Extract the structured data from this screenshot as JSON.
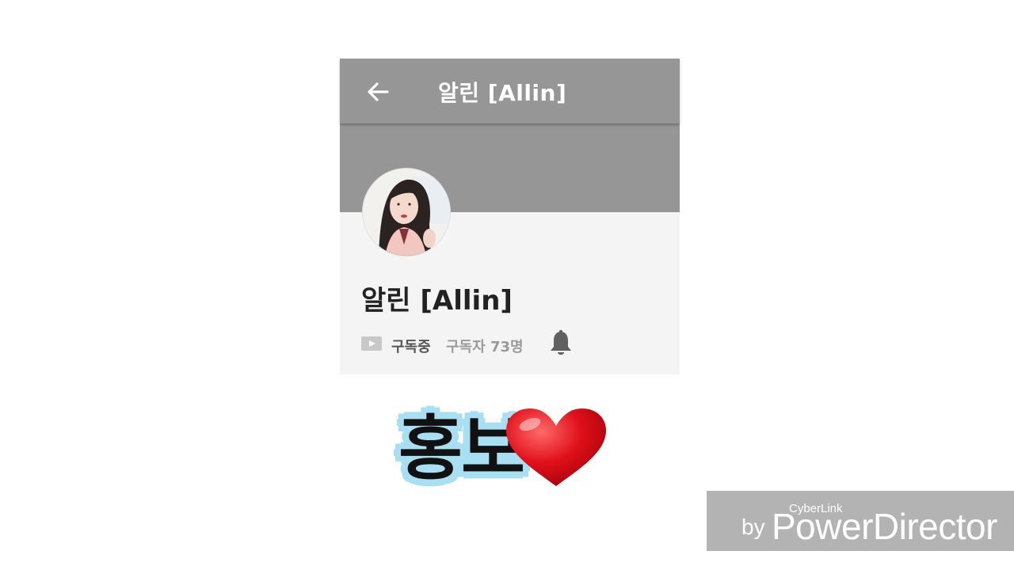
{
  "header": {
    "back_icon": "arrow-left-icon",
    "title": "알린 [Allin]"
  },
  "channel": {
    "avatar": "profile-photo",
    "name": "알린 [Allin]",
    "subscribed_label": "구독중",
    "subscriber_count": "구독자 73명",
    "bell_icon": "bell-icon",
    "play_icon": "youtube-play-icon"
  },
  "promo": {
    "text": "홍보",
    "heart_icon": "red-heart-icon"
  },
  "watermark": {
    "cyberlink": "CyberLink",
    "by": "by",
    "brand": "PowerDirector"
  },
  "colors": {
    "toolbar": "#969696",
    "panel": "#f4f4f4",
    "promo_outline": "#a9dff2",
    "heart": "#e0101a",
    "watermark_bg": "#b3b3b3"
  }
}
